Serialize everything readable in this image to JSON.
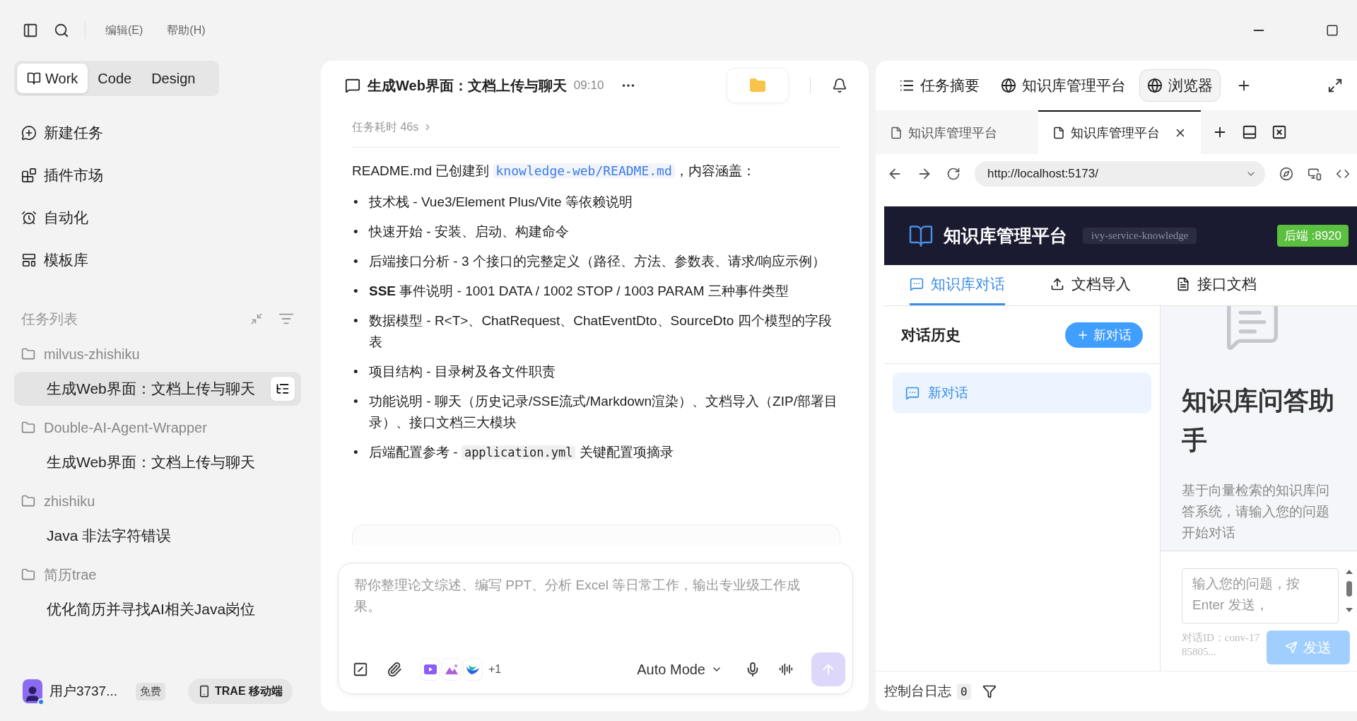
{
  "toolbar": {
    "menus": [
      "编辑(E)",
      "帮助(H)"
    ]
  },
  "modes": [
    {
      "label": "Work",
      "selected": true
    },
    {
      "label": "Code",
      "selected": false
    },
    {
      "label": "Design",
      "selected": false
    }
  ],
  "nav": [
    {
      "label": "新建任务",
      "kind": "new"
    },
    {
      "label": "插件市场",
      "kind": "plugins"
    },
    {
      "label": "自动化",
      "kind": "clock"
    },
    {
      "label": "模板库",
      "kind": "template"
    }
  ],
  "task_list": {
    "title": "任务列表",
    "groups": [
      {
        "name": "milvus-zhishiku",
        "children": [
          {
            "title": "生成Web界面：文档上传与聊天",
            "selected": true
          }
        ]
      },
      {
        "name": "Double-AI-Agent-Wrapper",
        "children": [
          {
            "title": "生成Web界面：文档上传与聊天",
            "selected": false
          }
        ]
      },
      {
        "name": "zhishiku",
        "children": [
          {
            "title": "Java 非法字符错误",
            "selected": false
          }
        ]
      },
      {
        "name": "简历trae",
        "children": [
          {
            "title": "优化简历并寻找AI相关Java岗位",
            "selected": false
          }
        ]
      }
    ]
  },
  "user": {
    "name": "用户3737...",
    "plan": "免费",
    "mobile": "TRAE 移动端"
  },
  "chat": {
    "title": "生成Web界面：文档上传与聊天",
    "time": "09:10",
    "duration": "任务耗时 46s",
    "intro": {
      "text": "README.md 已创建到",
      "code": "knowledge-web/README.md",
      "after": "，内容涵盖："
    },
    "bullets": [
      {
        "marker": "•",
        "text": "技术栈 - Vue3/Element Plus/Vite 等依赖说明"
      },
      {
        "marker": "•",
        "text": "快速开始 - 安装、启动、构建命令"
      },
      {
        "marker": "•",
        "text": "后端接口分析 - 3 个接口的完整定义（路径、方法、参数表、请求/响应示例）"
      },
      {
        "marker": "•",
        "text": "**SSE** 事件说明 - 1001 DATA / 1002 STOP / 1003 PARAM 三种事件类型"
      },
      {
        "marker": "•",
        "text": "数据模型 - R<T>、ChatRequest、ChatEventDto、SourceDto 四个模型的字段表"
      },
      {
        "marker": "•",
        "text": "项目结构 - 目录树及各文件职责"
      },
      {
        "marker": "•",
        "text": "功能说明 - 聊天（历史记录/SSE流式/Markdown渲染）、文档导入（ZIP/部署目录）、接口文档三大模块"
      },
      {
        "marker": "•",
        "text": "后端配置参考 -",
        "code": "application.yml",
        "after": "关键配置项摘录"
      }
    ],
    "composer": {
      "placeholder": "帮你整理论文综述、编写 PPT、分析 Excel 等日常工作，输出专业级工作成果。",
      "extra_tools": "+1",
      "mode": "Auto Mode"
    }
  },
  "panel_tabs": [
    {
      "label": "任务摘要",
      "kind": "list",
      "selected": false
    },
    {
      "label": "知识库管理平台",
      "kind": "globe",
      "selected": false
    },
    {
      "label": "浏览器",
      "kind": "globe",
      "selected": true
    }
  ],
  "browser": {
    "tabs": [
      {
        "title": "知识库管理平台",
        "selected": false
      },
      {
        "title": "知识库管理平台",
        "selected": true
      }
    ],
    "url": "http://localhost:5173/",
    "page": {
      "title": "知识库管理平台",
      "service": "ivy-service-knowledge",
      "backend": "后端 :8920",
      "tabs": [
        {
          "label": "知识库对话",
          "kind": "chat",
          "selected": true
        },
        {
          "label": "文档导入",
          "kind": "upload",
          "selected": false
        },
        {
          "label": "接口文档",
          "kind": "doc",
          "selected": false
        }
      ],
      "history_title": "对话历史",
      "new_button": "新对话",
      "conversations": [
        {
          "title": "新对话",
          "selected": true
        }
      ],
      "heading": "知识库问答助手",
      "description": "基于向量检索的知识库问答系统，请输入您的问题开始对话",
      "input_placeholder": "输入您的问题，按 Enter 发送，",
      "conversation_id": "对话ID：conv-1785805...",
      "send": "发送"
    }
  },
  "console": {
    "label": "控制台日志",
    "count": "0"
  }
}
